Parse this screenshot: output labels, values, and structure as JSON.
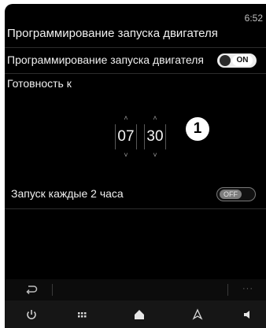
{
  "status": {
    "clock": "6:52"
  },
  "page": {
    "title": "Программирование запуска двигателя"
  },
  "engine_start_row": {
    "label": "Программирование запуска двигателя",
    "toggle_state": "ON"
  },
  "ready_at": {
    "label": "Готовность к",
    "hours": "07",
    "minutes": "30",
    "callout": "1"
  },
  "repeat_row": {
    "label": "Запуск каждые 2 часа",
    "toggle_state": "OFF"
  },
  "back_bar": {
    "back_icon": "return-arrow-icon",
    "more_label": "···"
  },
  "nav": {
    "icons": [
      "power-icon",
      "apps-grid-icon",
      "home-icon",
      "navigation-icon",
      "volume-icon"
    ]
  },
  "colors": {
    "background": "#000000",
    "text": "#f0f0f0",
    "toggle_on": "#ececec",
    "toggle_off": "#7d7d7d"
  }
}
